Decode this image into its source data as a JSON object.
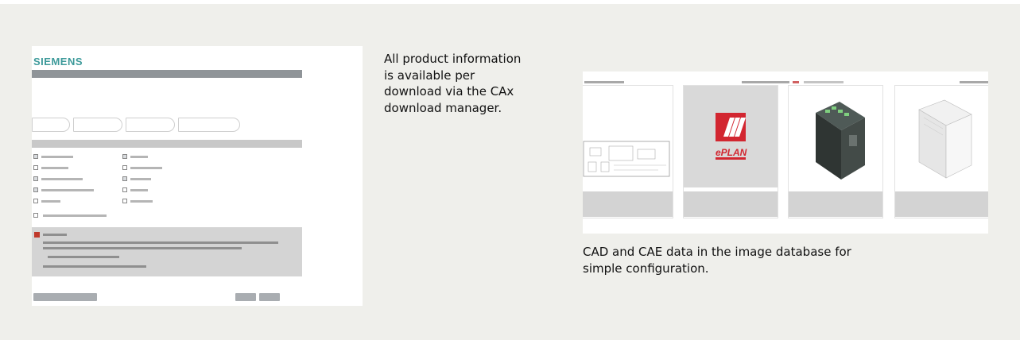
{
  "left_screenshot": {
    "logo": "SIEMENS"
  },
  "captions": {
    "middle": "All product information is available per download via the CAx download manager.",
    "right": "CAD and CAE data in the image database for simple configuration."
  },
  "colors": {
    "panel_background": "#efefeb",
    "siemens_teal": "#3d9a9a",
    "eplan_red": "#d22630"
  },
  "right_screenshot": {
    "products": [
      {
        "image": "technical-drawing",
        "label_visible": true
      },
      {
        "image": "eplan-logo",
        "logo_text": "EPLAN",
        "label_visible": true
      },
      {
        "image": "power-supply-module-dark",
        "label_visible": true
      },
      {
        "image": "power-supply-module-light",
        "label_visible": true
      }
    ]
  }
}
